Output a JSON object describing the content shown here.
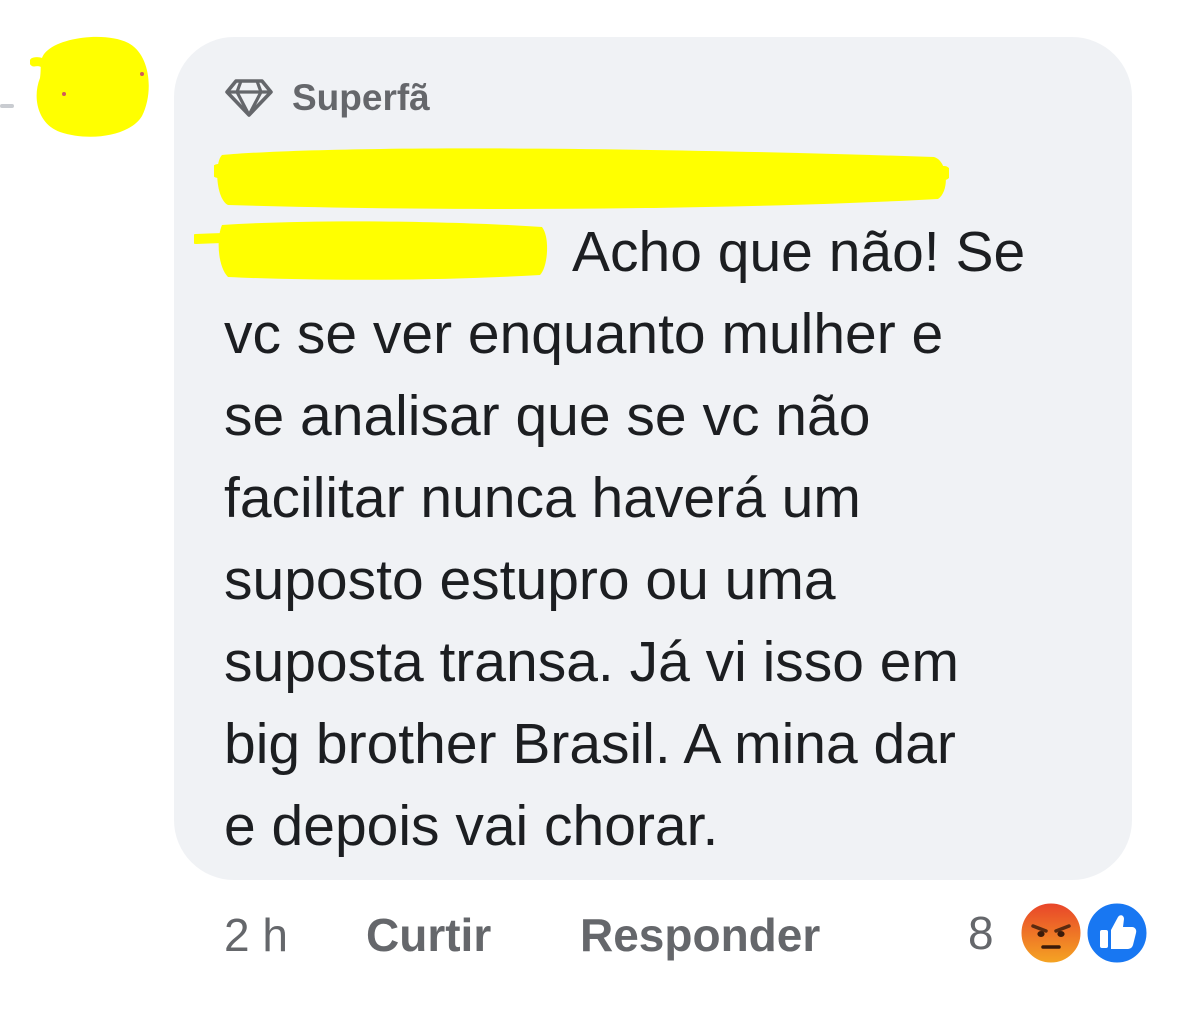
{
  "comment": {
    "badge_label": "Superfã",
    "badge_icon": "diamond-icon",
    "text_lines": [
      "Acho que não! Se",
      "vc se ver enquanto mulher e",
      "se analisar que se vc não",
      "facilitar nunca haverá um",
      "suposto estupro ou uma",
      "suposta transa. Já vi isso em",
      "big brother Brasil. A mina dar",
      "e depois vai chorar."
    ]
  },
  "actions": {
    "time": "2 h",
    "like_label": "Curtir",
    "reply_label": "Responder"
  },
  "reactions": {
    "count": "8",
    "icons": [
      "angry-reaction-icon",
      "like-reaction-icon"
    ]
  },
  "colors": {
    "bubble": "#f0f2f5",
    "redaction": "#ffff00",
    "text": "#1c1e21",
    "muted": "#65676b",
    "like_blue": "#1877f2",
    "angry_orange": "#f05a24"
  }
}
